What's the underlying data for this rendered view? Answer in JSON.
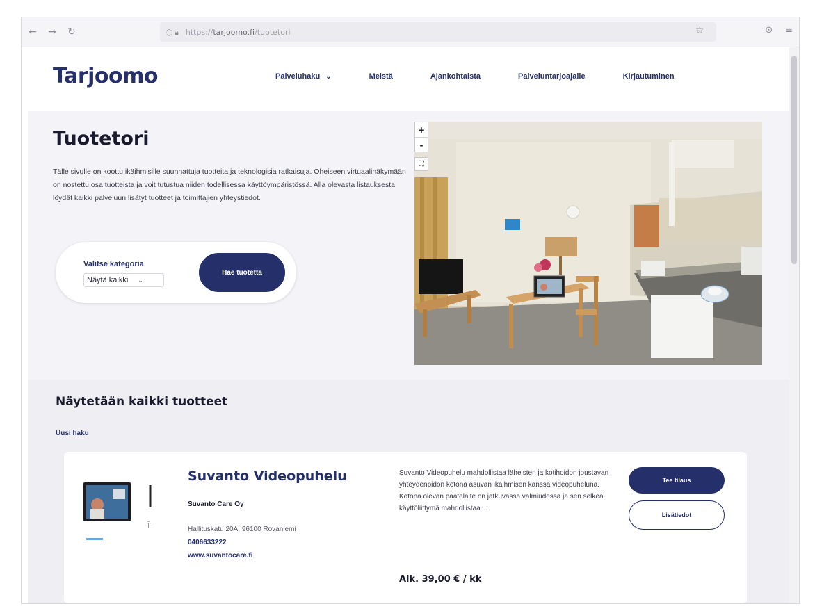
{
  "browser": {
    "url_prefix": "https://",
    "url_domain": "tarjoomo.fi",
    "url_path": "/tuotetori"
  },
  "header": {
    "logo": "Tarjoomo",
    "nav": [
      {
        "label": "Palveluhaku"
      },
      {
        "label": "Meistä"
      },
      {
        "label": "Ajankohtaista"
      },
      {
        "label": "Palveluntarjoajalle"
      },
      {
        "label": "Kirjautuminen"
      }
    ]
  },
  "hero": {
    "title": "Tuotetori",
    "description": "Tälle sivulle on koottu ikäihmisille suunnattuja tuotteita ja teknologisia ratkaisuja. Oheiseen virtuaalinäkymään on nostettu osa tuotteista ja voit tutustua niiden todellisessa käyttöympäristössä. Alla olevasta listauksesta löydät kaikki palveluun lisätyt tuotteet ja toimittajien yhteystiedot.",
    "filter": {
      "label": "Valitse kategoria",
      "selected": "Näytä kaikki",
      "search_button": "Hae tuotetta"
    },
    "viewer": {
      "zoom_in": "+",
      "zoom_out": "-"
    }
  },
  "results": {
    "title": "Näytetään kaikki tuotteet",
    "new_search": "Uusi haku",
    "products": [
      {
        "title": "Suvanto Videopuhelu",
        "company": "Suvanto Care Oy",
        "address": "Hallituskatu 20A, 96100 Rovaniemi",
        "phone": "0406633222",
        "website": "www.suvantocare.fi",
        "description": "Suvanto Videopuhelu mahdollistaa läheisten ja kotihoidon joustavan yhteydenpidon kotona asuvan ikäihmisen kanssa videopuheluna. Kotona olevan päätelaite on jatkuvassa valmiudessa ja sen selkeä käyttöliittymä mahdollistaa...",
        "price": "Alk. 39,00 € / kk",
        "order_button": "Tee tilaus",
        "info_button": "Lisätiedot"
      }
    ]
  },
  "colors": {
    "brand": "#25306b",
    "accent": "#2ab0c8",
    "hero_bg": "#f4f4f8",
    "results_bg": "#efeef2"
  }
}
